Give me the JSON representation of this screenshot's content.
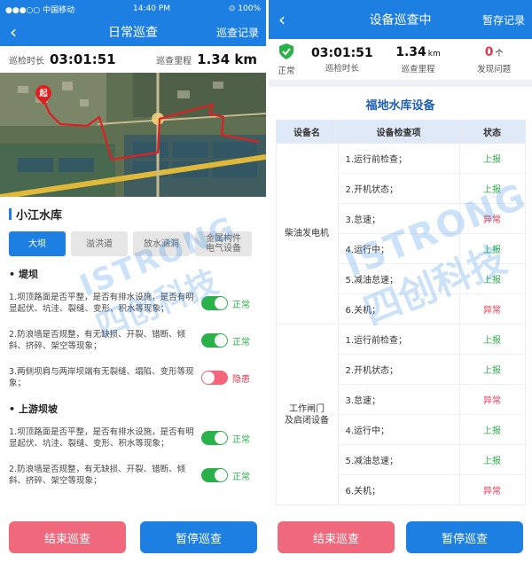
{
  "left": {
    "status_bar": {
      "carrier": "●●●○○ 中国移动",
      "time": "14:40 PM",
      "battery": "⊙ 100%"
    },
    "nav": {
      "title": "日常巡查",
      "right_action": "巡查记录"
    },
    "stats": {
      "duration_label": "巡检时长",
      "duration_value": "03:01:51",
      "distance_label": "巡查里程",
      "distance_value": "1.34 km"
    },
    "map": {
      "start_marker": "起"
    },
    "reservoir_title": "小江水库",
    "tabs": [
      {
        "label": "大坝",
        "active": true
      },
      {
        "label": "溢洪道",
        "active": false
      },
      {
        "label": "放水涵洞",
        "active": false
      },
      {
        "label": "金属构件\n电气设备",
        "active": false
      }
    ],
    "groups": [
      {
        "title": "堤坝",
        "items": [
          {
            "text": "1.坝顶路面是否平整，是否有排水设施，是否有明显起伏、坑洼、裂缝、变形、积水等现象；",
            "state": "on",
            "label": "正常"
          },
          {
            "text": "2.防浪墙是否规整，有无缺损、开裂、错断、倾斜、挤碎、架空等现象；",
            "state": "on",
            "label": "正常"
          },
          {
            "text": "3.两侧坝肩与两岸坝端有无裂缝、塌陷、变形等现象；",
            "state": "off",
            "label": "隐患"
          }
        ]
      },
      {
        "title": "上游坝坡",
        "items": [
          {
            "text": "1.坝顶路面是否平整，是否有排水设施，是否有明显起伏、坑洼、裂缝、变形、积水等现象；",
            "state": "on",
            "label": "正常"
          },
          {
            "text": "2.防浪墙是否规整，有无缺损、开裂、错断、倾斜、挤碎、架空等现象；",
            "state": "on",
            "label": "正常"
          }
        ]
      }
    ],
    "buttons": {
      "end": "结束巡查",
      "pause": "暂停巡查"
    }
  },
  "right": {
    "nav": {
      "title": "设备巡查中",
      "right_action": "暂存记录"
    },
    "stats": {
      "status": "正常",
      "duration_value": "03:01:51",
      "duration_label": "巡检时长",
      "distance_value": "1.34",
      "distance_unit": "km",
      "distance_label": "巡查里程",
      "issues_value": "0",
      "issues_unit": "个",
      "issues_label": "发现问题"
    },
    "card_title": "福地水库设备",
    "table": {
      "headers": [
        "设备名",
        "设备检查项",
        "状态"
      ],
      "groups": [
        {
          "name": "柴油发电机",
          "rows": [
            {
              "item": "1.运行前检查；",
              "status": "上报",
              "ok": true
            },
            {
              "item": "2.开机状态；",
              "status": "上报",
              "ok": true
            },
            {
              "item": "3.怠速；",
              "status": "异常",
              "ok": false
            },
            {
              "item": "4.运行中；",
              "status": "上报",
              "ok": true
            },
            {
              "item": "5.减油怠速；",
              "status": "上报",
              "ok": true
            },
            {
              "item": "6.关机；",
              "status": "异常",
              "ok": false
            }
          ]
        },
        {
          "name": "工作闸门\n及启闭设备",
          "rows": [
            {
              "item": "1.运行前检查；",
              "status": "上报",
              "ok": true
            },
            {
              "item": "2.开机状态；",
              "status": "上报",
              "ok": true
            },
            {
              "item": "3.怠速；",
              "status": "异常",
              "ok": false
            },
            {
              "item": "4.运行中；",
              "status": "上报",
              "ok": true
            },
            {
              "item": "5.减油怠速；",
              "status": "上报",
              "ok": true
            },
            {
              "item": "6.关机；",
              "status": "异常",
              "ok": false
            }
          ]
        }
      ]
    },
    "buttons": {
      "end": "结束巡查",
      "pause": "暂停巡查"
    }
  },
  "watermark": {
    "brand_en": "ISTRONG",
    "brand_cn": "四创科技"
  },
  "colors": {
    "primary": "#1e7fe3",
    "ok": "#2bb14a",
    "bad": "#e5384f",
    "danger_btn": "#f0687b"
  },
  "icons": {
    "back": "chevron-left-icon",
    "shield": "shield-check-icon",
    "start": "start-marker-icon"
  }
}
